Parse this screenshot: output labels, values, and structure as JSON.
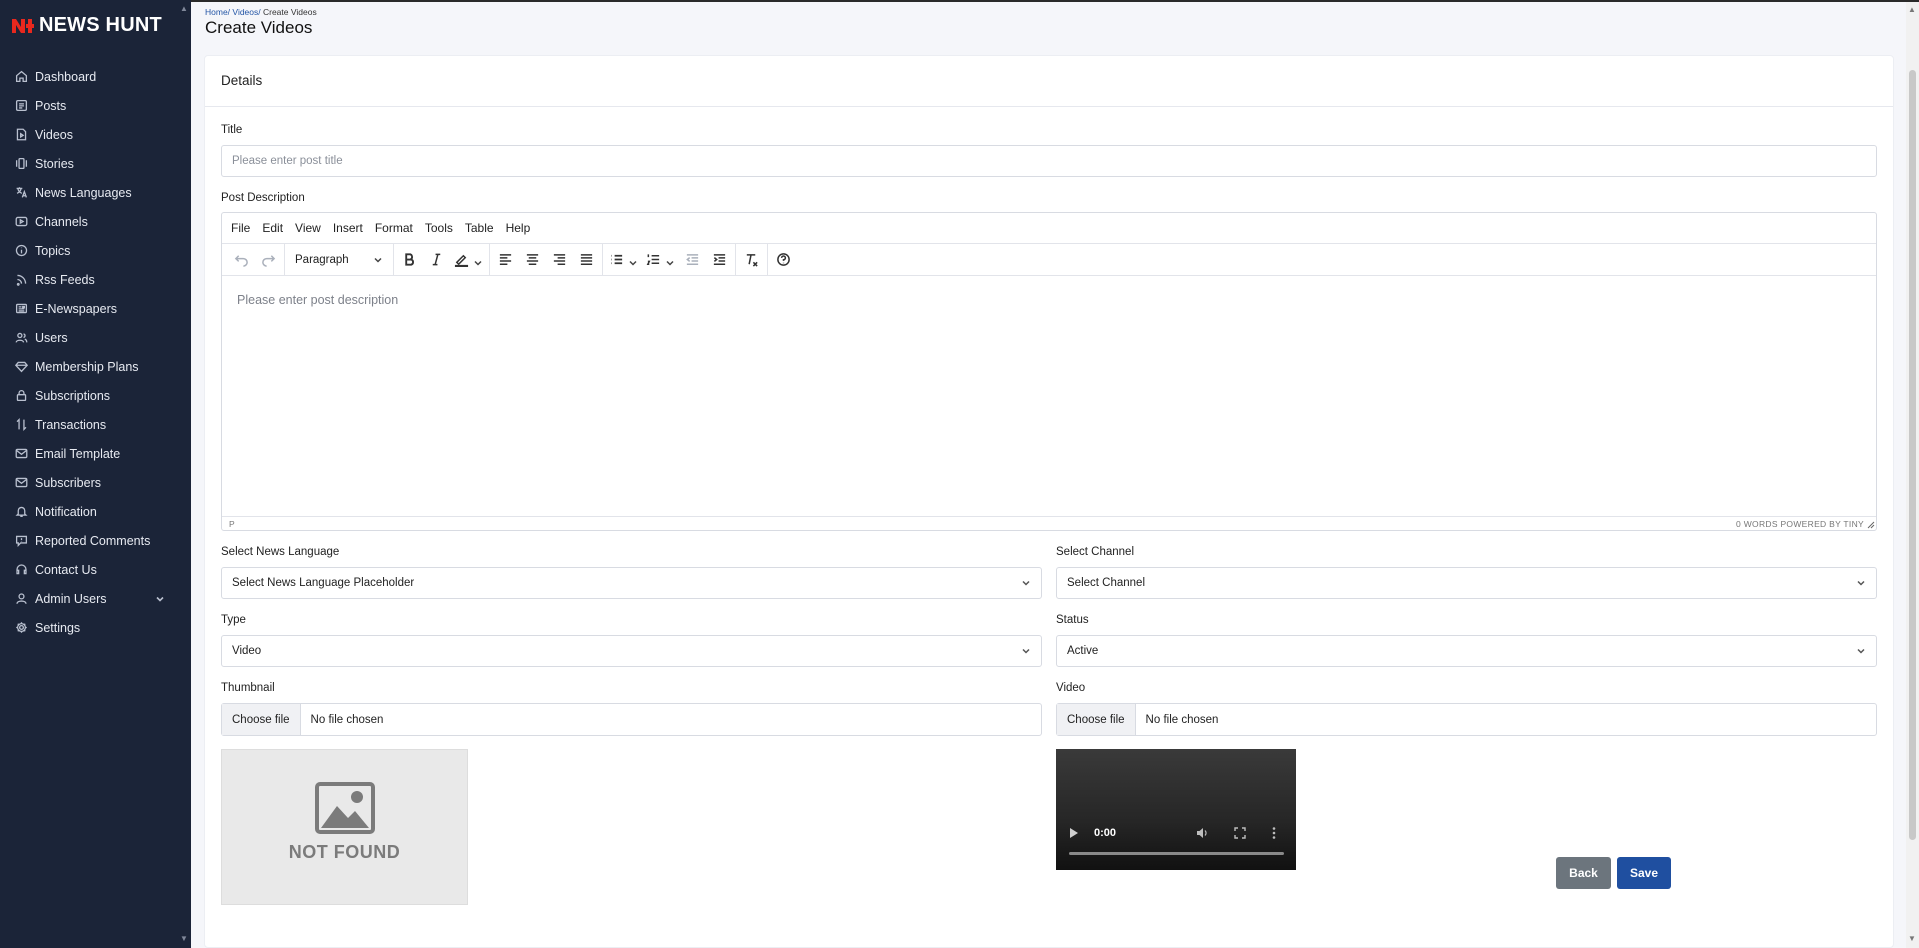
{
  "app": {
    "name": "NEWS HUNT",
    "brand_color": "#e8281e",
    "sidebar_bg": "#1b2438"
  },
  "sidebar": {
    "items": [
      {
        "label": "Dashboard",
        "icon": "home-icon"
      },
      {
        "label": "Posts",
        "icon": "list-icon"
      },
      {
        "label": "Videos",
        "icon": "video-file-icon"
      },
      {
        "label": "Stories",
        "icon": "stories-icon"
      },
      {
        "label": "News Languages",
        "icon": "translate-icon"
      },
      {
        "label": "Channels",
        "icon": "play-box-icon"
      },
      {
        "label": "Topics",
        "icon": "info-circle-icon"
      },
      {
        "label": "Rss Feeds",
        "icon": "rss-icon"
      },
      {
        "label": "E-Newspapers",
        "icon": "newspaper-icon"
      },
      {
        "label": "Users",
        "icon": "users-icon"
      },
      {
        "label": "Membership Plans",
        "icon": "diamond-icon"
      },
      {
        "label": "Subscriptions",
        "icon": "lock-icon"
      },
      {
        "label": "Transactions",
        "icon": "swap-icon"
      },
      {
        "label": "Email Template",
        "icon": "mail-icon"
      },
      {
        "label": "Subscribers",
        "icon": "mail-open-icon"
      },
      {
        "label": "Notification",
        "icon": "bell-icon"
      },
      {
        "label": "Reported Comments",
        "icon": "comment-alert-icon"
      },
      {
        "label": "Contact Us",
        "icon": "headset-icon"
      },
      {
        "label": "Admin Users",
        "icon": "user-icon"
      },
      {
        "label": "Settings",
        "icon": "gear-icon"
      }
    ]
  },
  "header": {
    "breadcrumb": {
      "home": "Home/",
      "videos": "Videos/",
      "current": " Create Videos"
    },
    "title": "Create Videos"
  },
  "card": {
    "title": "Details"
  },
  "form": {
    "title_label": "Title",
    "title_placeholder": "Please enter post title",
    "description_label": "Post Description",
    "editor": {
      "menu": [
        "File",
        "Edit",
        "View",
        "Insert",
        "Format",
        "Tools",
        "Table",
        "Help"
      ],
      "block_format": "Paragraph",
      "placeholder": "Please enter post description",
      "status_path": "P",
      "status_right": "0 WORDS  POWERED BY TINY"
    },
    "language_label": "Select News Language",
    "language_value": "Select News Language Placeholder",
    "channel_label": "Select Channel",
    "channel_value": "Select Channel",
    "type_label": "Type",
    "type_value": "Video",
    "status_label": "Status",
    "status_value": "Active",
    "thumbnail_label": "Thumbnail",
    "video_label": "Video",
    "choose_file": "Choose file",
    "no_file": "No file chosen",
    "thumbnail_preview_text": "NOT FOUND",
    "video_time": "0:00"
  },
  "actions": {
    "back": "Back",
    "save": "Save",
    "save_color": "#1f4fa0",
    "back_color": "#6c757d"
  }
}
